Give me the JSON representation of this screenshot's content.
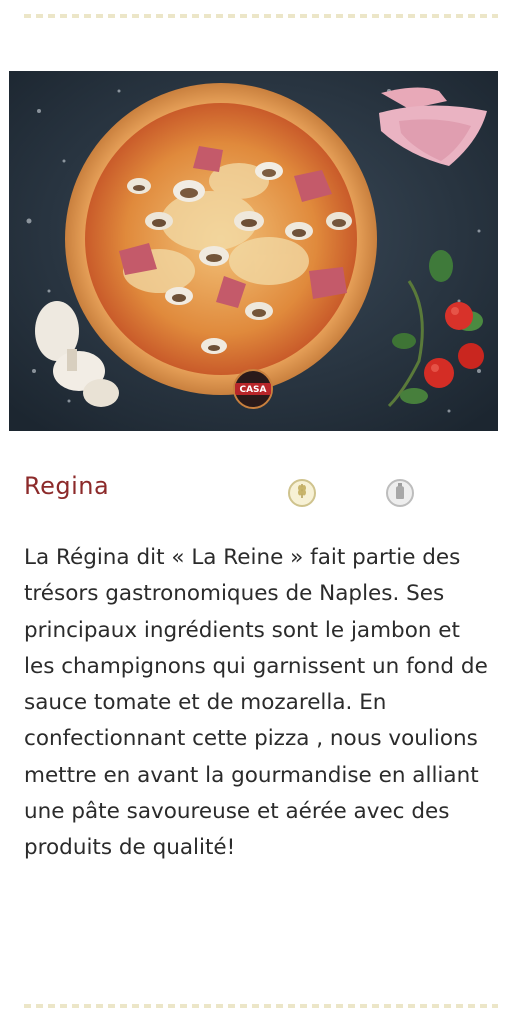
{
  "product": {
    "title": "Regina",
    "description": "La Régina dit « La Reine » fait partie des trésors gastronomiques de Naples. Ses principaux ingrédients sont le jambon et les champignons qui garnissent un fond de sauce tomate et de mozarella. En confectionnant cette pizza , nous voulions mettre en avant la gourmandise en alliant une pâte savoureuse et aérée avec des produits de qualité!",
    "logo_text": "CASA"
  },
  "badges": [
    {
      "icon": "wheat-icon",
      "color": "#cfc38d"
    },
    {
      "icon": "bottle-icon",
      "color": "#bdbdbd"
    }
  ],
  "colors": {
    "title": "#8c2a2a",
    "text": "#2b2b2b",
    "divider": "#ece6c8"
  }
}
